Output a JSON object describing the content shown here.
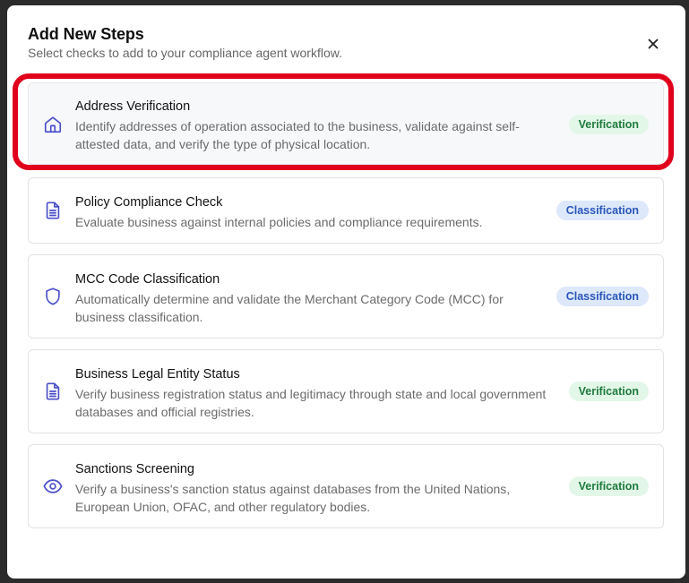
{
  "modal": {
    "title": "Add New Steps",
    "subtitle": "Select checks to add to your compliance agent workflow.",
    "close_icon": "close-icon"
  },
  "steps": [
    {
      "name": "Address Verification",
      "description": "Identify addresses of operation associated to the business, validate against self-attested data, and verify the type of physical location.",
      "badge": "Verification",
      "icon": "home-icon",
      "selected": true
    },
    {
      "name": "Policy Compliance Check",
      "description": "Evaluate business against internal policies and compliance requirements.",
      "badge": "Classification",
      "icon": "document-icon",
      "selected": false
    },
    {
      "name": "MCC Code Classification",
      "description": "Automatically determine and validate the Merchant Category Code (MCC) for business classification.",
      "badge": "Classification",
      "icon": "shield-icon",
      "selected": false
    },
    {
      "name": "Business Legal Entity Status",
      "description": "Verify business registration status and legitimacy through state and local government databases and official registries.",
      "badge": "Verification",
      "icon": "document-icon",
      "selected": false
    },
    {
      "name": "Sanctions Screening",
      "description": "Verify a business's sanction status against databases from the United Nations, European Union, OFAC, and other regulatory bodies.",
      "badge": "Verification",
      "icon": "eye-icon",
      "selected": false
    }
  ],
  "colors": {
    "icon": "#4b4fc9",
    "verification_bg": "#e3f7e9",
    "verification_text": "#1f7a3d",
    "classification_bg": "#dde8fb",
    "classification_text": "#2a56b8",
    "highlight": "#e0001b"
  }
}
